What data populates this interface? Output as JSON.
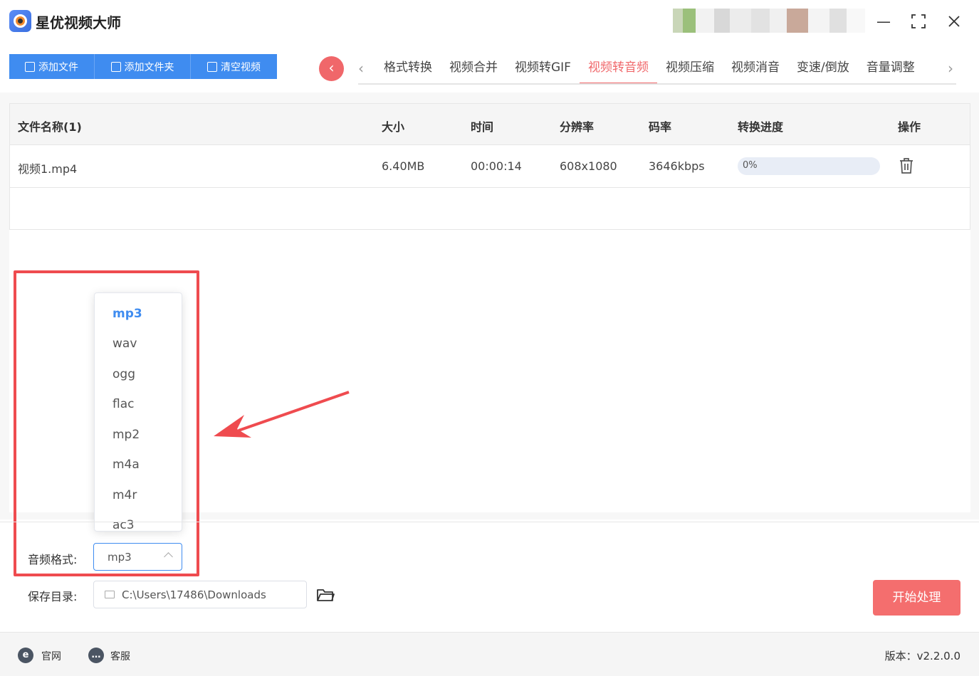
{
  "app": {
    "title": "星优视频大师"
  },
  "toolbar": {
    "add_file": "添加文件",
    "add_folder": "添加文件夹",
    "clear": "清空视频"
  },
  "tabs": [
    "格式转换",
    "视频合并",
    "视频转GIF",
    "视频转音频",
    "视频压缩",
    "视频消音",
    "变速/倒放",
    "音量调整"
  ],
  "active_tab": "视频转音频",
  "table": {
    "headers": [
      "文件名称(1)",
      "大小",
      "时间",
      "分辨率",
      "码率",
      "转换进度",
      "操作"
    ],
    "rows": [
      {
        "name": "视频1.mp4",
        "size": "6.40MB",
        "time": "00:00:14",
        "resolution": "608x1080",
        "bitrate": "3646kbps",
        "progress": "0%"
      }
    ]
  },
  "dropdown": {
    "options": [
      "mp3",
      "wav",
      "ogg",
      "flac",
      "mp2",
      "m4a",
      "m4r",
      "ac3"
    ],
    "selected": "mp3"
  },
  "settings": {
    "audio_format_label": "音频格式:",
    "audio_format_value": "mp3",
    "save_dir_label": "保存目录:",
    "save_dir_value": "C:\\Users\\17486\\Downloads",
    "start_button": "开始处理"
  },
  "footer": {
    "website": "官网",
    "service": "客服",
    "version": "版本：v2.2.0.0"
  },
  "colors": {
    "primary": "#3f8cf0",
    "accent": "#f0676a",
    "highlight": "#ef4b4f"
  }
}
